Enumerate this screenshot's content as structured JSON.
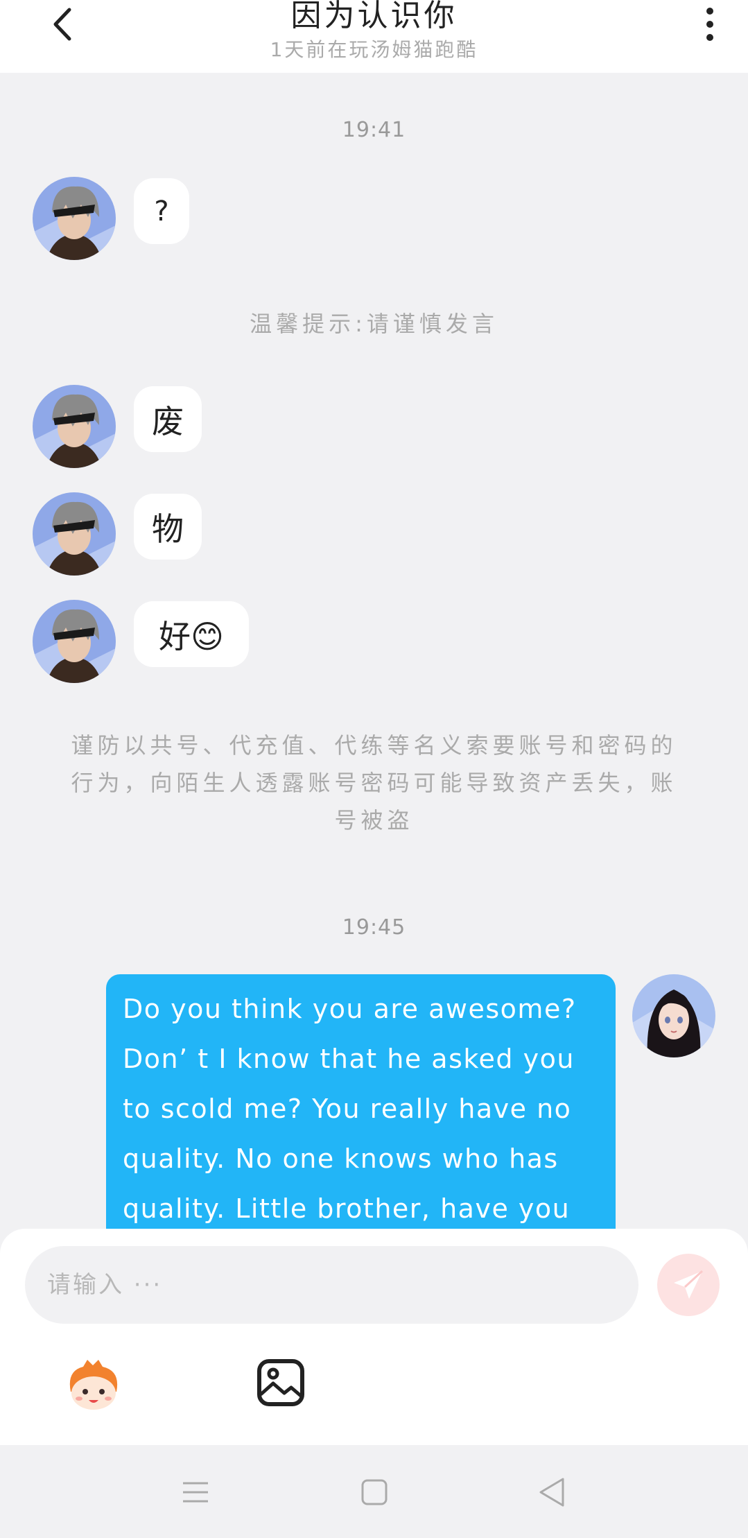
{
  "header": {
    "title": "因为认识你",
    "subtitle": "1天前在玩汤姆猫跑酷"
  },
  "chat": {
    "time_1": "19:41",
    "msg_1": "?",
    "notice_1": "温馨提示:请谨慎发言",
    "msg_2": "废",
    "msg_3": "物",
    "msg_4": "好😊",
    "notice_2": "谨防以共号、代充值、代练等名义索要账号和密码的行为，向陌生人透露账号密码可能导致资产丢失，账号被盗",
    "time_2": "19:45",
    "msg_out": "Do you think you are awesome? Don’ t I know that he asked you to scold me? You really have no quality. No one knows who has quality. Little brother, have you"
  },
  "input": {
    "placeholder": "请输入 ···"
  },
  "colors": {
    "accent_blue": "#22b5f7",
    "send_inactive": "#fde2e2",
    "background": "#f1f1f3"
  },
  "icons": {
    "back": "chevron-left-icon",
    "more": "more-vertical-icon",
    "send": "paper-plane-icon",
    "emoji": "cartoon-emoji-icon",
    "image": "image-icon",
    "nav_menu": "menu-icon",
    "nav_home": "square-icon",
    "nav_back": "triangle-back-icon"
  }
}
